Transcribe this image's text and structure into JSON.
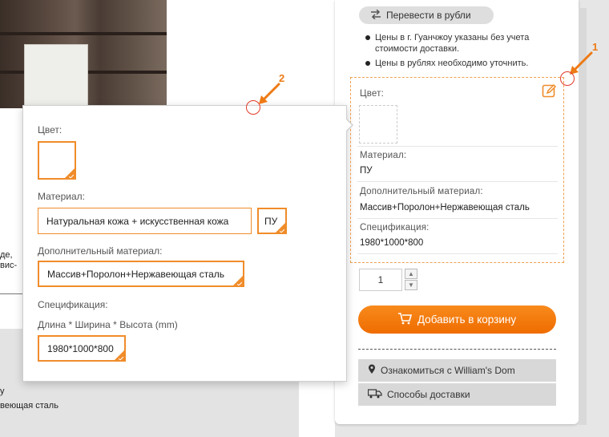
{
  "background": {
    "fragment_1": "де,",
    "fragment_2": "вис-",
    "fragment_3": "у",
    "fragment_4": "веющая сталь"
  },
  "right_panel": {
    "convert_button": "Перевести в рубли",
    "convert_icon": "exchange-arrows-icon",
    "notes": [
      "Цены в г. Гуанчжоу указаны без учета стоимости доставки.",
      "Цены в рублях необходимо уточнить."
    ],
    "selection": {
      "color_label": "Цвет:",
      "material_label": "Материал:",
      "material_value": "ПУ",
      "extra_material_label": "Дополнительный материал:",
      "extra_material_value": "Массив+Поролон+Нержавеющая сталь",
      "spec_label": "Спецификация:",
      "spec_value": "1980*1000*800",
      "edit_icon": "edit-pencil-icon"
    },
    "quantity": "1",
    "add_to_cart_button": "Добавить в корзину",
    "cart_icon": "shopping-cart-icon",
    "learn_button": "Ознакомиться с William's Dom",
    "learn_icon": "map-pin-icon",
    "delivery_button": "Способы доставки",
    "delivery_icon": "truck-icon"
  },
  "popup": {
    "color_label": "Цвет:",
    "material_label": "Материал:",
    "material_options": [
      "Натуральная кожа + искусственная кожа",
      "ПУ"
    ],
    "extra_material_label": "Дополнительный материал:",
    "extra_material_option": "Массив+Поролон+Нержавеющая сталь",
    "spec_label": "Спецификация:",
    "spec_sublabel": "Длина * Ширина * Высота (mm)",
    "spec_option": "1980*1000*800"
  },
  "annotations": {
    "marker_1": "1",
    "marker_2": "2",
    "accent_color": "#f08c2a",
    "circle_color": "#e23a2a"
  }
}
